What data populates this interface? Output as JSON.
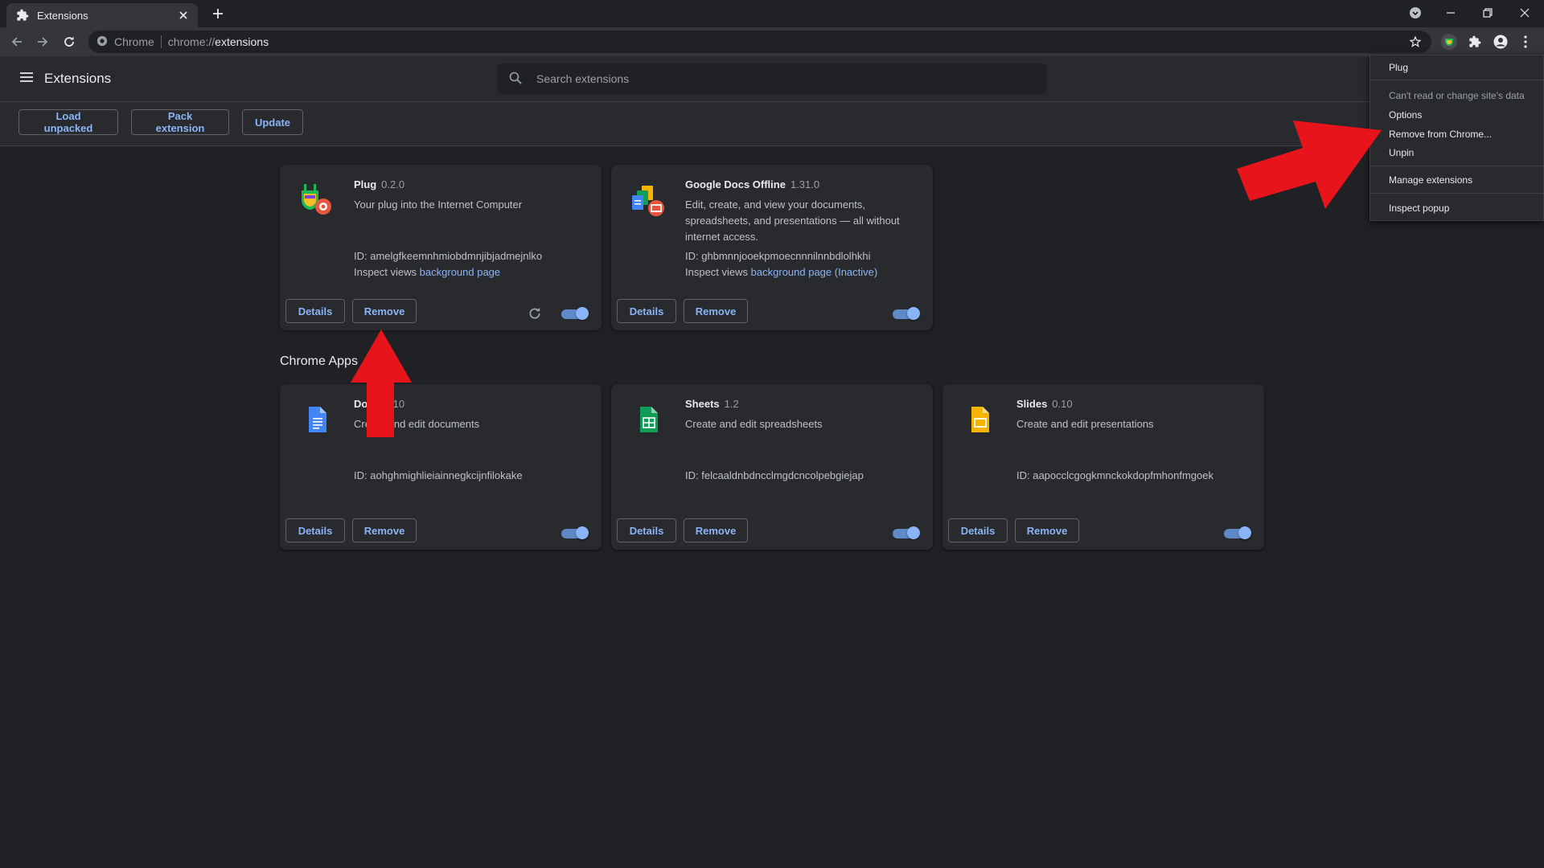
{
  "browser": {
    "tab_title": "Extensions",
    "omnibox": {
      "origin": "Chrome",
      "scheme": "chrome://",
      "path": "extensions"
    }
  },
  "header": {
    "title": "Extensions",
    "search_placeholder": "Search extensions"
  },
  "dev_toolbar": {
    "load_unpacked": "Load unpacked",
    "pack_extension": "Pack extension",
    "update": "Update"
  },
  "extensions": [
    {
      "name": "Plug",
      "version": "0.2.0",
      "description": "Your plug into the Internet Computer",
      "id": "ID: amelgfkeemnhmiobdmnjibjadmejnlko",
      "inspect_prefix": "Inspect views",
      "inspect_link": "background page",
      "details": "Details",
      "remove": "Remove",
      "enabled": true
    },
    {
      "name": "Google Docs Offline",
      "version": "1.31.0",
      "description": "Edit, create, and view your documents, spreadsheets, and presentations — all without internet access.",
      "id": "ID: ghbmnnjooekpmoecnnnilnnbdlolhkhi",
      "inspect_prefix": "Inspect views",
      "inspect_link": "background page (Inactive)",
      "details": "Details",
      "remove": "Remove",
      "enabled": true
    }
  ],
  "apps_section": {
    "title": "Chrome Apps",
    "apps": [
      {
        "name": "Docs",
        "version": "0.10",
        "description": "Create and edit documents",
        "id": "ID: aohghmighlieiainnegkcijnfilokake",
        "details": "Details",
        "remove": "Remove",
        "enabled": true,
        "color": "#4285f4"
      },
      {
        "name": "Sheets",
        "version": "1.2",
        "description": "Create and edit spreadsheets",
        "id": "ID: felcaaldnbdncclmgdcncolpebgiejap",
        "details": "Details",
        "remove": "Remove",
        "enabled": true,
        "color": "#0f9d58"
      },
      {
        "name": "Slides",
        "version": "0.10",
        "description": "Create and edit presentations",
        "id": "ID: aapocclcgogkmnckokdopfmhonfmgoek",
        "details": "Details",
        "remove": "Remove",
        "enabled": true,
        "color": "#f4b400"
      }
    ]
  },
  "extension_menu": {
    "title": "Plug",
    "site_access": "Can't read or change site's data",
    "options": "Options",
    "remove": "Remove from Chrome...",
    "unpin": "Unpin",
    "manage": "Manage extensions",
    "inspect": "Inspect popup"
  },
  "colors": {
    "accent": "#8ab4f8",
    "annotation_arrow": "#e8141c",
    "background": "#202124",
    "card": "#292a2d"
  }
}
